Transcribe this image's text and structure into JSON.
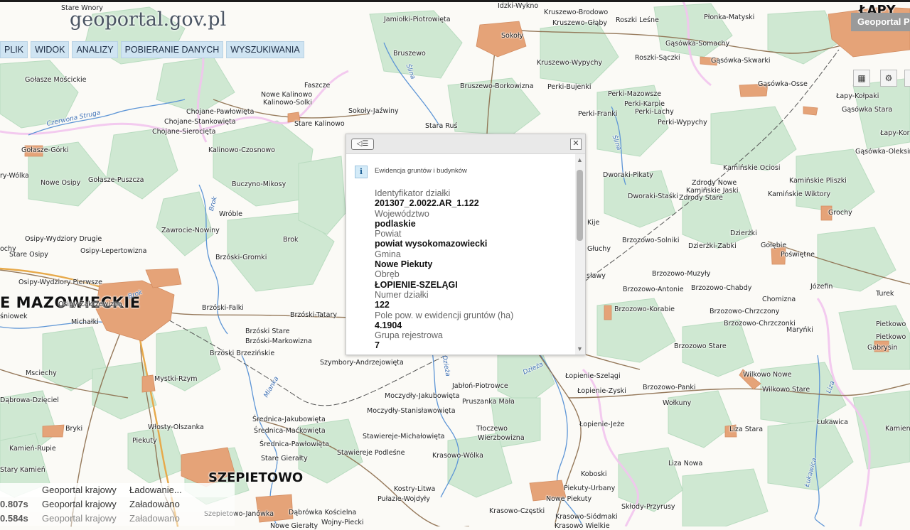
{
  "app": {
    "logo": "geoportal.gov.pl",
    "tab_title": "Geoportal P"
  },
  "menu": [
    "PLIK",
    "WIDOK",
    "ANALIZY",
    "POBIERANIE DANYCH",
    "WYSZUKIWANIA"
  ],
  "popup": {
    "section_title": "Ewidencja gruntów i budynków",
    "fields": [
      {
        "label": "Identyfikator działki",
        "value": "201307_2.0022.AR_1.122"
      },
      {
        "label": "Województwo",
        "value": "podlaskie"
      },
      {
        "label": "Powiat",
        "value": "powiat wysokomazowiecki"
      },
      {
        "label": "Gmina",
        "value": "Nowe Piekuty"
      },
      {
        "label": "Obręb",
        "value": "ŁOPIENIE-SZELĄGI"
      },
      {
        "label": "Numer działki",
        "value": "122"
      },
      {
        "label": "Pole pow. w ewidencji gruntów (ha)",
        "value": "4.1904"
      },
      {
        "label": "Grupa rejestrowa",
        "value": "7"
      }
    ]
  },
  "status": [
    {
      "time": "",
      "server": "Geoportal krajowy",
      "state": "Ładowanie..."
    },
    {
      "time": "0.807s",
      "server": "Geoportal krajowy",
      "state": "Załadowano"
    },
    {
      "time": "0.584s",
      "server": "Geoportal krajowy",
      "state": "Załadowano"
    }
  ],
  "map": {
    "large_labels": [
      "E MAZOWIECKIE",
      "SZEPIETOWO",
      "ŁAPY"
    ],
    "place_labels": [
      "Stare Wnory",
      "Jamiołki-Piotrowięta",
      "Idzki-Wykno",
      "Kruszewo-Brodowo",
      "Kruszewo-Głąby",
      "Roszki Leśne",
      "Płonka-Matyski",
      "Sokoły",
      "Gąsówka-Somachy",
      "Roszki-Sączki",
      "Gąsówka-Skwarki",
      "Kruszewo-Wypychy",
      "Bruszewo",
      "Gołasze Mościckie",
      "Faszcze",
      "Nowe Kalinowo",
      "Kalinowo-Solki",
      "Bruszewo-Borkowizna",
      "Perki-Bujenki",
      "Perki-Mazowsze",
      "Perki-Karpie",
      "Perki-Lachy",
      "Perki-Franki",
      "Perki-Wypychy",
      "Gąsówka-Osse",
      "Łapy-Kołpaki",
      "Gąsówka Stara",
      "Chojane-Pawłowięta",
      "Chojane-Stankowięta",
      "Chojane-Sierocięta",
      "Stare Kalinowo",
      "Sokoły-Jaźwiny",
      "Stara Ruś",
      "Łapy-Kor",
      "Gołasze-Górki",
      "Kalinowo-Czosnowo",
      "Gąsówka-Oleksin",
      "Dworaki-Pikaty",
      "Kamińskie Ociosi",
      "Kamińskie Pliszki",
      "ry-Wólka",
      "Nowe Osipy",
      "Gołasze-Puszcza",
      "Buczyno-Mikosy",
      "Zdrody Nowe",
      "Kamińskie Jaski",
      "Kamińskie Wiktory",
      "Dworaki-Staśki",
      "Zdrody Stare",
      "Wróble",
      "Grochy",
      "Zawrocie-Nowiny",
      "Osipy-Wydziory Drugie",
      "Dzierżki",
      "Brzozowo-Solniki",
      "Dzierżki-Zabki",
      "Gołębie",
      "Osipy-Lepertowizna",
      "Kije",
      "Głuchy",
      "Poświętne",
      "Brok",
      "Stare Osipy",
      "ochy",
      "Brzóski-Gromki",
      "Osipy-Wydziory Pierwsze",
      "Brzozowo-Muzyły",
      "Józefin",
      "Brzozowo-Antonie",
      "Brzozowo-Chabdy",
      "Chomizna",
      "Turek",
      "sławy",
      "Osipy-Zakrzewizna",
      "śniowek",
      "Michałki",
      "Brzóski-Falki",
      "Brzóski-Tatary",
      "Brzozowo-Korabie",
      "Brzozowo-Chrzczony",
      "Brzozowo-Chrzczonki",
      "Maryńki",
      "Pietkowo",
      "Pietkowo",
      "Brzóski Stare",
      "Brzóski-Markowizna",
      "Brzóski Brzezińskie",
      "Brzozowo Stare",
      "Gabrysin",
      "Szymbory-Andrzejowięta",
      "Msciechy",
      "Mystki-Rzym",
      "Łopienie-Szelągi",
      "Wilkowo Nowe",
      "Wilkowo Stare",
      "Jabłoń-Piotrowce",
      "Łopienie-Zyski",
      "Brzozowo-Panki",
      "Moczydły-Jakubowięta",
      "Pruszanka Mała",
      "Wołkuny",
      "Dąbrowa-Dzięciel",
      "Moczydły-Stanisławowięta",
      "Łukawica",
      "Bryki",
      "Włosty-Olszanka",
      "Średnica-Jakubowięta",
      "Średnica-Maćkowięta",
      "Stawiereje-Michałowięta",
      "Tłoczewo",
      "Wierzbowizna",
      "Łopienie-Jeże",
      "Liza Stara",
      "Kamienn",
      "Piekuty",
      "Kamień-Rupie",
      "Średnica-Pawłowięta",
      "Stawiereje Podleśne",
      "Krasowo-Wólka",
      "Stare Gierałty",
      "Liza Nowa",
      "Stary Kamień",
      "Koboski",
      "Kostry-Litwa",
      "Piekuty-Urbany",
      "Pułazie-Wojdyły",
      "Nowe Piekuty",
      "Skłody-Przyrusy",
      "Dąbrówka Kościelna",
      "Krasowo-Częstki",
      "Krasowo-Siódmaki",
      "Wojny-Piecki",
      "Nowe Gierałty",
      "Szepietowo-Janówka",
      "Krasowo Wielkie"
    ],
    "river_labels": [
      "Czerwona Struga",
      "Ślina",
      "Ślina",
      "Brok",
      "Brok",
      "Mianka",
      "Dzieża",
      "Dzieża",
      "Liza",
      "Łukawica"
    ]
  }
}
